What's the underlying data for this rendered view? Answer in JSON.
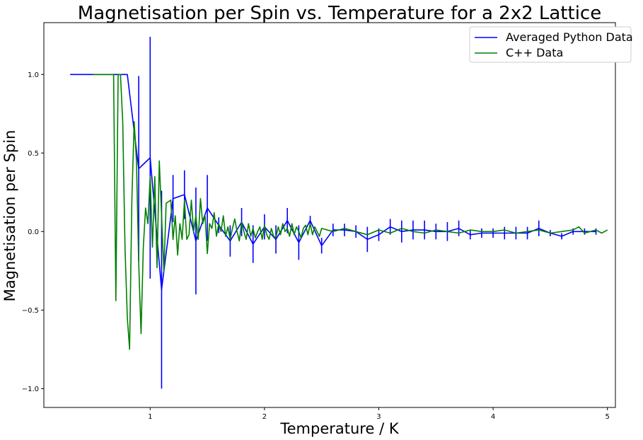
{
  "chart_data": {
    "type": "line",
    "title": "Magnetisation per Spin vs. Temperature for a 2x2 Lattice",
    "xlabel": "Temperature / K",
    "ylabel": "Magnetisation per Spin",
    "xlim": [
      0.07,
      5.07
    ],
    "ylim": [
      -1.12,
      1.33
    ],
    "xticks": [
      1,
      2,
      3,
      4,
      5
    ],
    "yticks": [
      -1.0,
      -0.5,
      0.0,
      0.5,
      1.0
    ],
    "xtick_labels": [
      "1",
      "2",
      "3",
      "4",
      "5"
    ],
    "ytick_labels": [
      "−1.0",
      "−0.5",
      "0.0",
      "0.5",
      "1.0"
    ],
    "grid": false,
    "legend_position": "top-right",
    "series": [
      {
        "name": "Averaged Python Data",
        "color": "#0000ff",
        "x": [
          0.3,
          0.4,
          0.5,
          0.6,
          0.7,
          0.8,
          0.9,
          1.0,
          1.1,
          1.2,
          1.3,
          1.4,
          1.5,
          1.6,
          1.7,
          1.8,
          1.9,
          2.0,
          2.1,
          2.2,
          2.3,
          2.4,
          2.5,
          2.6,
          2.7,
          2.8,
          2.9,
          3.0,
          3.1,
          3.2,
          3.3,
          3.4,
          3.5,
          3.6,
          3.7,
          3.8,
          3.9,
          4.0,
          4.1,
          4.2,
          4.3,
          4.4,
          4.5,
          4.6,
          4.7,
          4.8,
          4.9
        ],
        "y": [
          1.0,
          1.0,
          1.0,
          1.0,
          1.0,
          1.0,
          0.4,
          0.47,
          -0.37,
          0.21,
          0.235,
          -0.06,
          0.15,
          0.04,
          -0.06,
          0.06,
          -0.08,
          0.03,
          -0.05,
          0.07,
          -0.07,
          0.07,
          -0.09,
          0.01,
          0.01,
          0.0,
          -0.05,
          -0.02,
          0.03,
          0.0,
          0.01,
          0.01,
          0.0,
          0.0,
          0.02,
          -0.02,
          -0.01,
          -0.01,
          -0.01,
          -0.01,
          -0.01,
          0.02,
          -0.01,
          -0.03,
          0.0,
          0.0,
          0.0
        ],
        "yerr": [
          0,
          0,
          0,
          0,
          0,
          0,
          0.59,
          0.77,
          0.63,
          0.15,
          0.155,
          0.34,
          0.21,
          0.05,
          0.1,
          0.09,
          0.12,
          0.08,
          0.09,
          0.08,
          0.11,
          0.03,
          0.05,
          0.04,
          0.04,
          0.04,
          0.08,
          0.04,
          0.05,
          0.07,
          0.06,
          0.06,
          0.05,
          0.06,
          0.05,
          0.03,
          0.03,
          0.03,
          0.04,
          0.04,
          0.04,
          0.05,
          0.02,
          0.02,
          0.02,
          0.02,
          0.02
        ]
      },
      {
        "name": "C++ Data",
        "color": "#008000",
        "x": [
          0.5,
          0.68,
          0.7,
          0.72,
          0.74,
          0.76,
          0.78,
          0.8,
          0.82,
          0.84,
          0.86,
          0.88,
          0.9,
          0.92,
          0.94,
          0.96,
          0.98,
          1.0,
          1.02,
          1.04,
          1.06,
          1.08,
          1.1,
          1.12,
          1.14,
          1.16,
          1.18,
          1.2,
          1.22,
          1.24,
          1.26,
          1.28,
          1.3,
          1.32,
          1.34,
          1.36,
          1.38,
          1.4,
          1.42,
          1.44,
          1.46,
          1.48,
          1.5,
          1.52,
          1.54,
          1.56,
          1.58,
          1.6,
          1.62,
          1.64,
          1.66,
          1.68,
          1.7,
          1.72,
          1.74,
          1.76,
          1.78,
          1.8,
          1.82,
          1.84,
          1.86,
          1.88,
          1.9,
          1.92,
          1.94,
          1.96,
          1.98,
          2.0,
          2.02,
          2.04,
          2.06,
          2.08,
          2.1,
          2.12,
          2.14,
          2.16,
          2.18,
          2.2,
          2.22,
          2.24,
          2.26,
          2.28,
          2.3,
          2.32,
          2.34,
          2.36,
          2.38,
          2.4,
          2.42,
          2.44,
          2.46,
          2.48,
          2.5,
          2.6,
          2.7,
          2.8,
          2.9,
          3.0,
          3.1,
          3.2,
          3.3,
          3.4,
          3.5,
          3.6,
          3.7,
          3.8,
          3.9,
          4.0,
          4.1,
          4.2,
          4.3,
          4.4,
          4.5,
          4.6,
          4.7,
          4.75,
          4.8,
          4.85,
          4.9,
          4.95,
          5.0
        ],
        "y": [
          1.0,
          1.0,
          -0.44,
          1.0,
          1.0,
          0.7,
          -0.1,
          -0.55,
          -0.75,
          0.2,
          0.7,
          0.45,
          -0.2,
          -0.65,
          -0.1,
          0.15,
          0.05,
          0.35,
          -0.1,
          0.35,
          -0.23,
          0.45,
          0.1,
          -0.25,
          0.18,
          0.19,
          0.2,
          -0.05,
          0.1,
          -0.15,
          0.05,
          -0.05,
          0.2,
          -0.05,
          -0.02,
          0.2,
          0.0,
          0.1,
          -0.05,
          0.21,
          0.05,
          0.1,
          -0.14,
          0.05,
          0.02,
          0.12,
          -0.03,
          0.05,
          0.0,
          0.1,
          -0.03,
          0.03,
          -0.05,
          0.02,
          0.08,
          0.0,
          -0.06,
          0.06,
          0.0,
          -0.05,
          0.05,
          -0.03,
          0.02,
          -0.04,
          0.0,
          0.03,
          -0.05,
          0.04,
          -0.02,
          -0.05,
          0.02,
          -0.03,
          -0.04,
          0.03,
          -0.02,
          0.05,
          0.0,
          0.02,
          -0.03,
          0.05,
          -0.02,
          0.03,
          0.0,
          -0.04,
          0.02,
          0.04,
          -0.02,
          0.05,
          -0.02,
          0.03,
          0.0,
          -0.03,
          0.02,
          0.0,
          0.02,
          0.0,
          -0.02,
          0.01,
          -0.01,
          0.02,
          0.0,
          -0.01,
          0.01,
          0.0,
          -0.01,
          0.01,
          0.0,
          0.0,
          0.01,
          -0.01,
          0.0,
          0.01,
          -0.01,
          0.0,
          0.01,
          0.03,
          -0.01,
          0.0,
          0.01,
          -0.01,
          0.01
        ]
      }
    ]
  }
}
